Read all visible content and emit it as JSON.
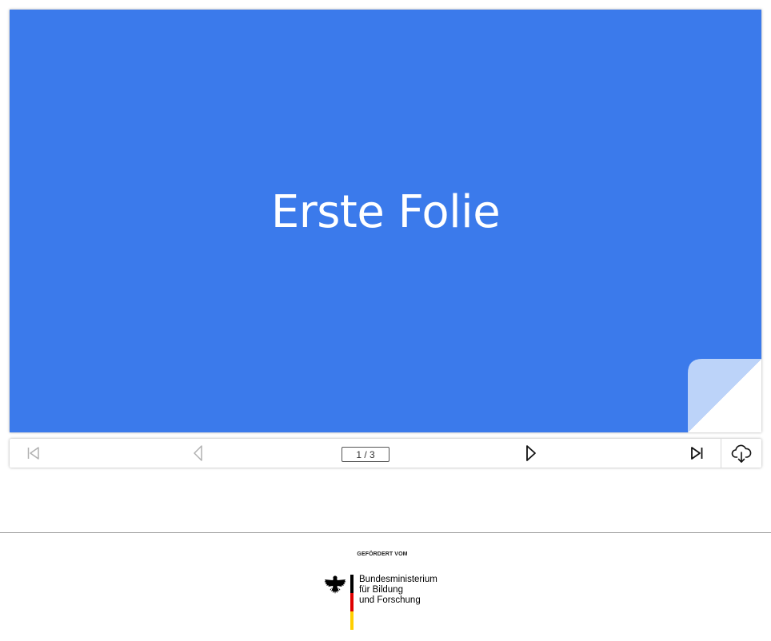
{
  "slide": {
    "title": "Erste Folie",
    "background_color": "#3b7aeb",
    "title_color": "#ffffff"
  },
  "toolbar": {
    "first_icon": "skip-to-first-icon",
    "prev_icon": "previous-icon",
    "page_counter": "1 / 3",
    "next_icon": "next-icon",
    "last_icon": "skip-to-last-icon",
    "download_icon": "cloud-download-icon",
    "disabled_color": "#b0b0b0",
    "enabled_color": "#111111"
  },
  "footer": {
    "caption": "GEFÖRDERT VOM",
    "ministry_line1": "Bundesministerium",
    "ministry_line2": "für Bildung",
    "ministry_line3": "und Forschung",
    "flag_colors": [
      "#000000",
      "#dd0000",
      "#ffce00"
    ]
  }
}
